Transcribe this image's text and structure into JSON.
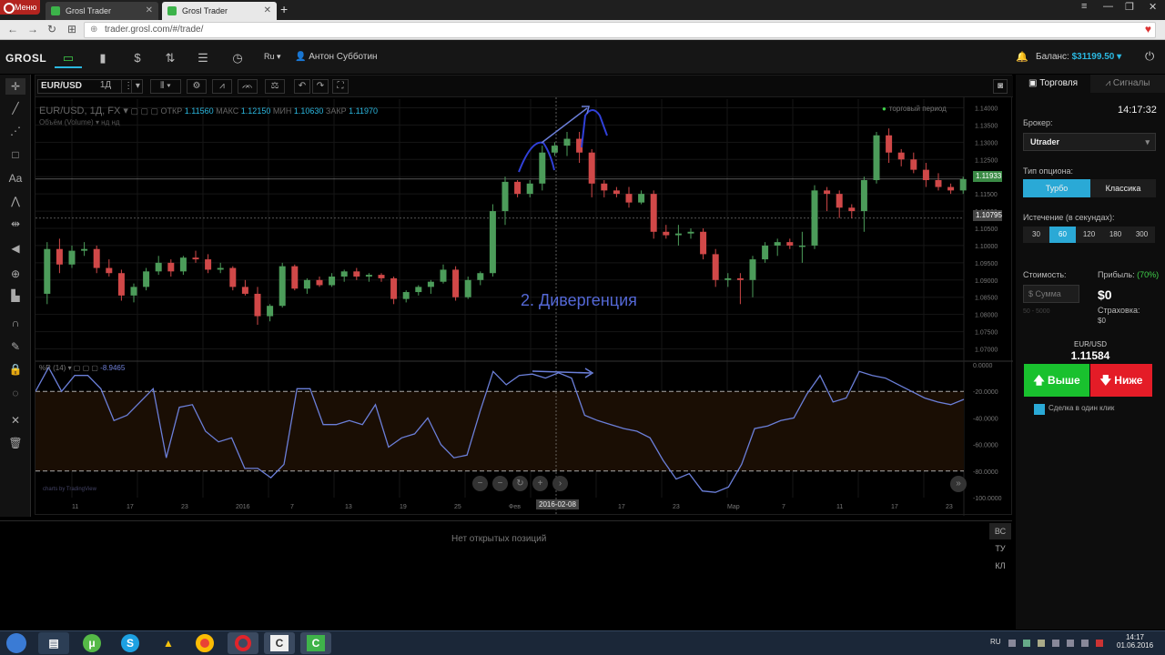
{
  "browser": {
    "menu_label": "Меню",
    "tabs": [
      {
        "title": "Grosl Trader",
        "active": false
      },
      {
        "title": "Grosl Trader",
        "active": true
      }
    ],
    "new_tab": "+",
    "url": "trader.grosl.com/#/trade/"
  },
  "app": {
    "logo": "GROSL",
    "language": "Ru ▾",
    "user": "Антон Субботин",
    "balance_label": "Баланс:",
    "balance_value": "$31199.50 ▾",
    "accent": "#2bb8e0"
  },
  "chart": {
    "symbol": "EUR/USD",
    "interval": "1Д",
    "legend": {
      "title": "EUR/USD, 1Д, FX ▾",
      "open_label": "ОТКР",
      "open": "1.11560",
      "high_label": "МАКС",
      "high": "1.12150",
      "low_label": "МИН",
      "low": "1.10630",
      "close_label": "ЗАКР",
      "close": "1.11970",
      "volume_line": "Объём (Volume) ▾   нд   нд"
    },
    "trial_label": "торговый период",
    "oscillator_legend": "%R (14)",
    "oscillator_value": "-8.9465",
    "annotation": "2. Дивергенция",
    "date_marker": "2016-02-08",
    "current_price_tag": "1.11933",
    "cursor_price_tag": "1.10795",
    "powered_by": "charts by TradingView",
    "price_axis": [
      "1.14000",
      "1.13500",
      "1.13000",
      "1.12500",
      "1.12000",
      "1.11500",
      "1.11000",
      "1.10500",
      "1.10000",
      "1.09500",
      "1.09000",
      "1.08500",
      "1.08000",
      "1.07500",
      "1.07000"
    ],
    "osc_axis": [
      "0.0000",
      "-20.0000",
      "-40.0000",
      "-60.0000",
      "-80.0000",
      "-100.0000"
    ],
    "time_axis": [
      "11",
      "17",
      "23",
      "2016",
      "7",
      "13",
      "19",
      "25",
      "Фев",
      "11",
      "17",
      "23",
      "Мар",
      "7",
      "11",
      "17",
      "23"
    ]
  },
  "chart_data": [
    {
      "type": "candlestick",
      "title": "EUR/USD, 1Д, FX",
      "ylim": [
        1.0675,
        1.1425
      ],
      "ohlc": [
        [
          1.086,
          1.101,
          1.083,
          1.099
        ],
        [
          1.099,
          1.102,
          1.092,
          1.0945
        ],
        [
          1.0945,
          1.1,
          1.0935,
          1.0985
        ],
        [
          1.0985,
          1.101,
          1.097,
          1.099
        ],
        [
          1.099,
          1.1,
          1.092,
          1.0935
        ],
        [
          1.0935,
          1.096,
          1.091,
          1.092
        ],
        [
          1.092,
          1.093,
          1.084,
          1.0855
        ],
        [
          1.0855,
          1.089,
          1.0835,
          1.088
        ],
        [
          1.088,
          1.0935,
          1.087,
          1.0925
        ],
        [
          1.0925,
          1.097,
          1.0915,
          1.095
        ],
        [
          1.095,
          1.096,
          1.091,
          1.0925
        ],
        [
          1.0925,
          1.097,
          1.0915,
          1.0965
        ],
        [
          1.0965,
          1.0985,
          1.095,
          1.096
        ],
        [
          1.096,
          1.0975,
          1.092,
          1.093
        ],
        [
          1.093,
          1.095,
          1.092,
          1.0935
        ],
        [
          1.0935,
          1.094,
          1.087,
          1.088
        ],
        [
          1.088,
          1.09,
          1.0855,
          1.086
        ],
        [
          1.086,
          1.088,
          1.077,
          1.0795
        ],
        [
          1.0795,
          1.083,
          1.078,
          1.0825
        ],
        [
          1.0825,
          1.095,
          1.082,
          1.094
        ],
        [
          1.094,
          1.0945,
          1.087,
          1.0875
        ],
        [
          1.0875,
          1.0905,
          1.086,
          1.09
        ],
        [
          1.09,
          1.091,
          1.088,
          1.0885
        ],
        [
          1.0885,
          1.092,
          1.088,
          1.091
        ],
        [
          1.091,
          1.093,
          1.0895,
          1.0925
        ],
        [
          1.0925,
          1.0935,
          1.09,
          1.091
        ],
        [
          1.091,
          1.092,
          1.0895,
          1.0915
        ],
        [
          1.0915,
          1.092,
          1.0895,
          1.0905
        ],
        [
          1.0905,
          1.091,
          1.083,
          1.0845
        ],
        [
          1.0845,
          1.087,
          1.0835,
          1.0865
        ],
        [
          1.0865,
          1.0885,
          1.0855,
          1.088
        ],
        [
          1.088,
          1.09,
          1.086,
          1.0895
        ],
        [
          1.0895,
          1.0945,
          1.089,
          1.093
        ],
        [
          1.093,
          1.094,
          1.084,
          1.085
        ],
        [
          1.085,
          1.091,
          1.0845,
          1.09
        ],
        [
          1.09,
          1.0925,
          1.0885,
          1.092
        ],
        [
          1.092,
          1.112,
          1.091,
          1.11
        ],
        [
          1.11,
          1.12,
          1.106,
          1.1185
        ],
        [
          1.1185,
          1.119,
          1.114,
          1.115
        ],
        [
          1.115,
          1.119,
          1.114,
          1.118
        ],
        [
          1.118,
          1.129,
          1.116,
          1.127
        ],
        [
          1.127,
          1.13,
          1.126,
          1.129
        ],
        [
          1.129,
          1.133,
          1.126,
          1.131
        ],
        [
          1.131,
          1.133,
          1.124,
          1.127
        ],
        [
          1.127,
          1.128,
          1.114,
          1.118
        ],
        [
          1.118,
          1.119,
          1.114,
          1.116
        ],
        [
          1.116,
          1.117,
          1.114,
          1.115
        ],
        [
          1.115,
          1.117,
          1.111,
          1.1125
        ],
        [
          1.1125,
          1.116,
          1.112,
          1.115
        ],
        [
          1.115,
          1.116,
          1.102,
          1.104
        ],
        [
          1.104,
          1.106,
          1.102,
          1.103
        ],
        [
          1.103,
          1.106,
          1.1,
          1.1035
        ],
        [
          1.1035,
          1.105,
          1.102,
          1.104
        ],
        [
          1.104,
          1.105,
          1.096,
          1.0975
        ],
        [
          1.0975,
          1.099,
          1.088,
          1.09
        ],
        [
          1.09,
          1.092,
          1.088,
          1.0905
        ],
        [
          1.0905,
          1.092,
          1.083,
          1.09
        ],
        [
          1.09,
          1.097,
          1.085,
          1.096
        ],
        [
          1.096,
          1.101,
          1.095,
          1.1
        ],
        [
          1.1,
          1.102,
          1.097,
          1.101
        ],
        [
          1.101,
          1.102,
          1.099,
          1.1
        ],
        [
          1.1,
          1.104,
          1.095,
          1.1
        ],
        [
          1.1,
          1.1175,
          1.099,
          1.116
        ],
        [
          1.116,
          1.117,
          1.11,
          1.115
        ],
        [
          1.115,
          1.116,
          1.108,
          1.111
        ],
        [
          1.111,
          1.112,
          1.108,
          1.11
        ],
        [
          1.11,
          1.12,
          1.104,
          1.119
        ],
        [
          1.119,
          1.133,
          1.118,
          1.132
        ],
        [
          1.132,
          1.134,
          1.124,
          1.127
        ],
        [
          1.127,
          1.128,
          1.123,
          1.125
        ],
        [
          1.125,
          1.127,
          1.121,
          1.122
        ],
        [
          1.122,
          1.124,
          1.117,
          1.119
        ],
        [
          1.119,
          1.121,
          1.116,
          1.117
        ],
        [
          1.117,
          1.118,
          1.115,
          1.116
        ],
        [
          1.116,
          1.12,
          1.115,
          1.1193
        ]
      ]
    },
    {
      "type": "line",
      "title": "%R (14)",
      "ylim": [
        -100,
        0
      ],
      "levels": [
        -20,
        -80
      ],
      "values": [
        -20,
        -2,
        -20,
        -8,
        -8,
        -18,
        -42,
        -38,
        -28,
        -18,
        -70,
        -32,
        -30,
        -50,
        -58,
        -55,
        -78,
        -78,
        -85,
        -75,
        -18,
        -18,
        -45,
        -45,
        -42,
        -45,
        -30,
        -62,
        -55,
        -52,
        -40,
        -60,
        -70,
        -68,
        -35,
        -5,
        -15,
        -8,
        -7,
        -10,
        -6,
        -10,
        -38,
        -42,
        -45,
        -48,
        -50,
        -55,
        -72,
        -86,
        -82,
        -95,
        -96,
        -92,
        -75,
        -48,
        -46,
        -42,
        -40,
        -22,
        -8,
        -28,
        -25,
        -5,
        -8,
        -10,
        -15,
        -20,
        -25,
        -28,
        -30,
        -26
      ]
    }
  ],
  "positions": {
    "empty_text": "Нет открытых позиций",
    "tabs": [
      "ВС",
      "ТУ",
      "КЛ"
    ]
  },
  "trade_panel": {
    "tab_trade": "Торговля",
    "tab_signals": "Сигналы",
    "time": "14:17:32",
    "broker_label": "Брокер:",
    "broker_value": "Utrader",
    "option_type_label": "Тип опциона:",
    "option_types": [
      "Турбо",
      "Классика"
    ],
    "expiry_label": "Истечение (в секундах):",
    "expiry_options": [
      "30",
      "60",
      "120",
      "180",
      "300"
    ],
    "selected_expiry": "60",
    "cost_label": "Стоимость:",
    "amount_placeholder": "$ Сумма",
    "amount_range": "50 - 5000",
    "profit_label": "Прибыль:",
    "profit_pct": "(70%)",
    "profit_value": "$0",
    "insurance_label": "Страховка:",
    "insurance_value": "$0",
    "pair": "EUR/USD",
    "pair_price": "1.11584",
    "up_label": "🡅 Выше",
    "down_label": "🡇 Ниже",
    "one_click": "Сделка в один клик",
    "up_color": "#19c12e",
    "down_color": "#e41c27"
  },
  "taskbar": {
    "lang": "RU",
    "time": "14:17",
    "date": "01.06.2016"
  }
}
